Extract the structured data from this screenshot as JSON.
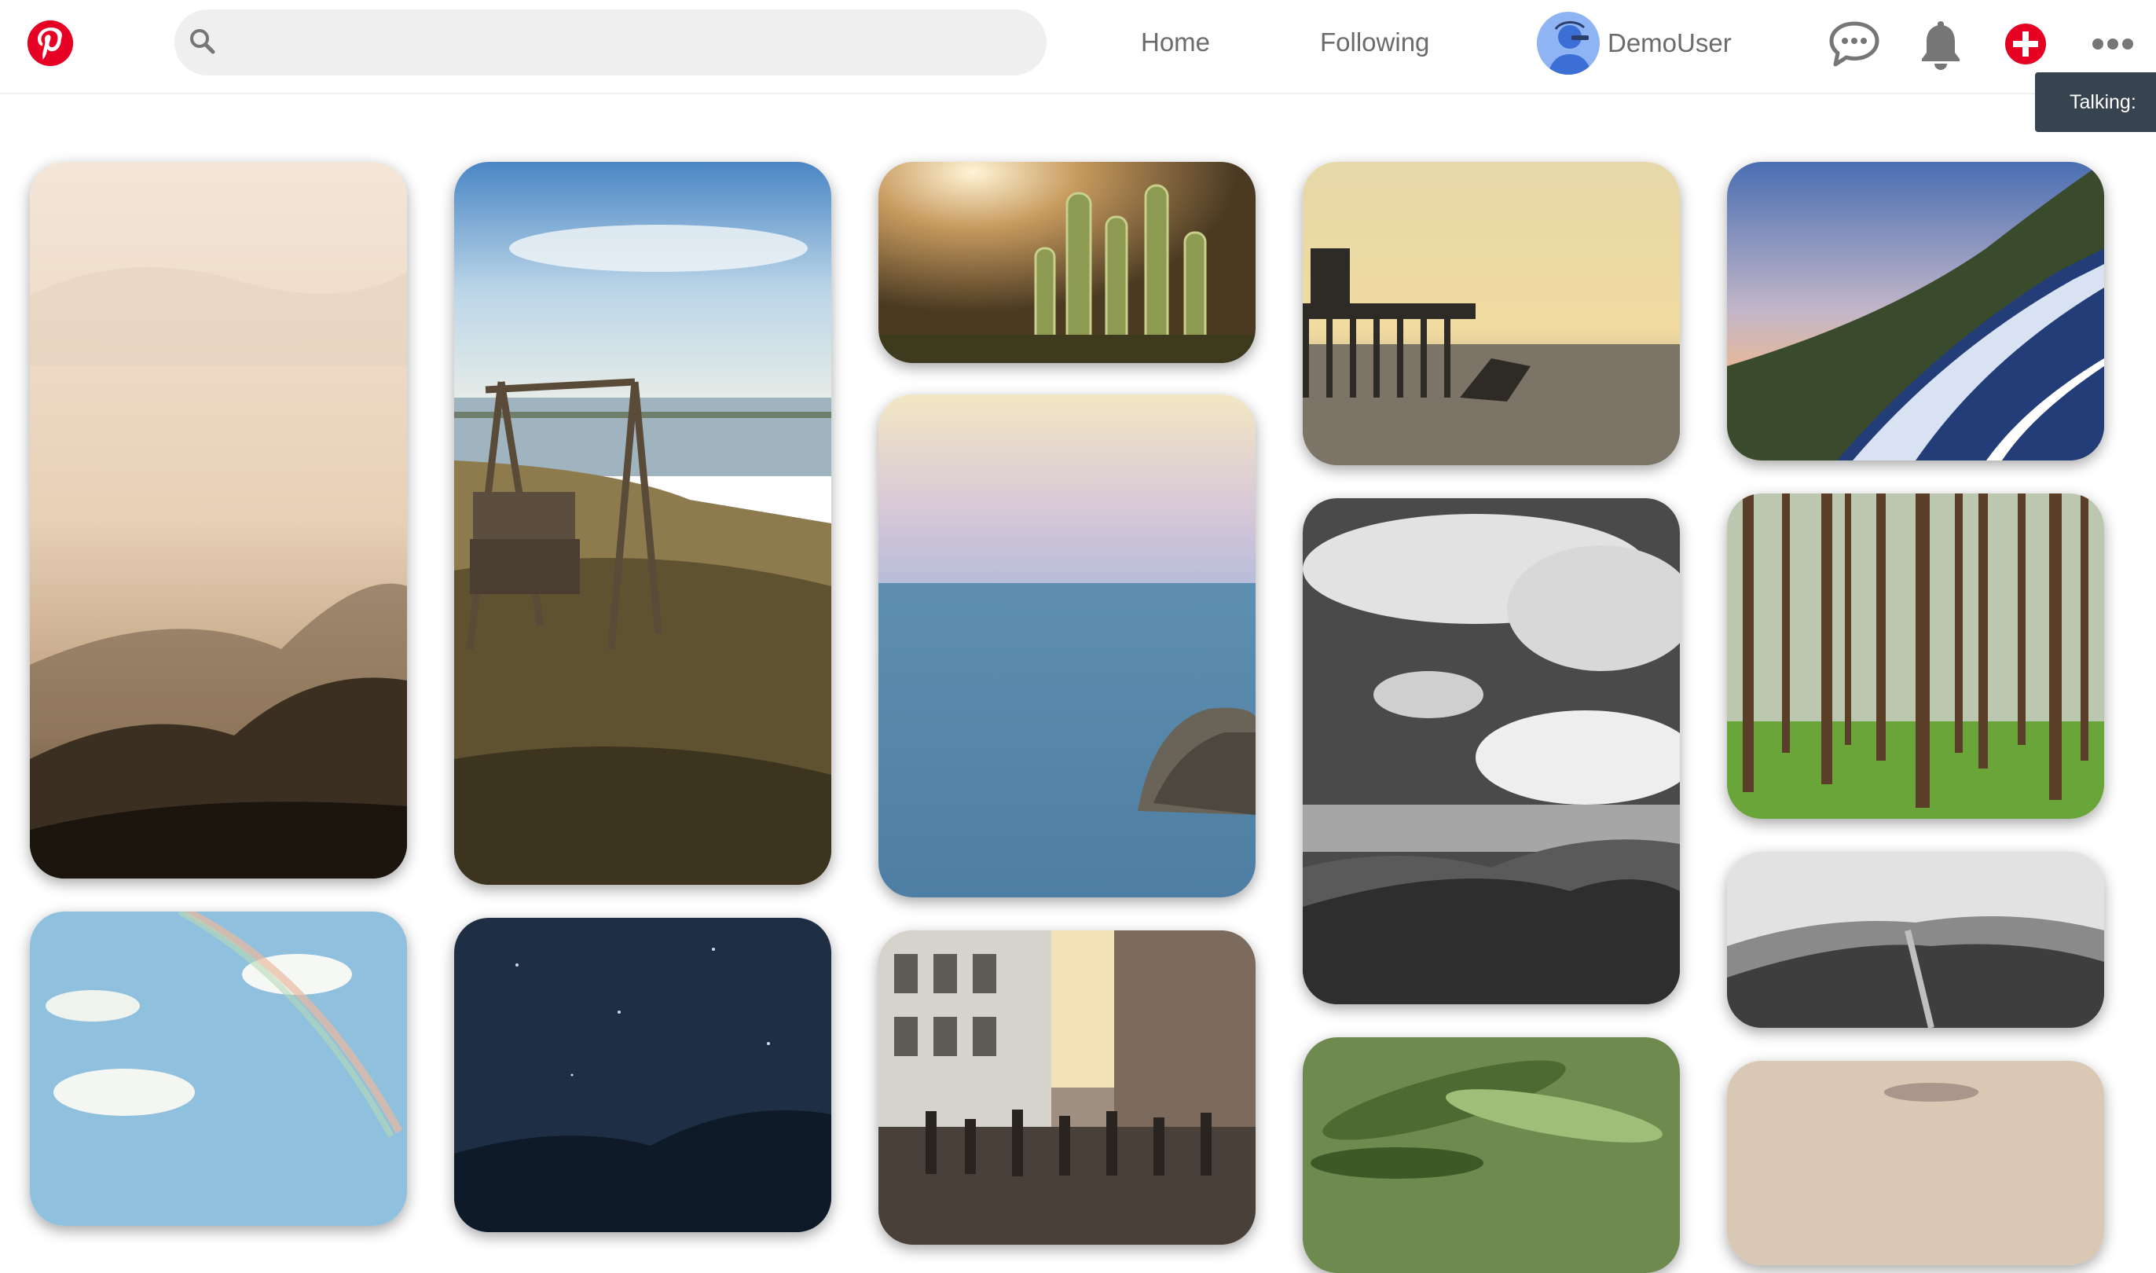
{
  "header": {
    "logo_icon": "pinterest-logo-icon",
    "search": {
      "value": "",
      "placeholder": "",
      "icon": "search-icon"
    },
    "nav": {
      "home": "Home",
      "following": "Following"
    },
    "user": {
      "name": "DemoUser",
      "avatar_icon": "avatar-icon"
    },
    "icons": [
      "chat-bubble-icon",
      "bell-icon",
      "add-plus-icon",
      "more-dots-icon"
    ],
    "brand_color": "#e60023"
  },
  "tooltip": {
    "text": "Talking:"
  },
  "pins": [
    {
      "name": "pin-foggy-mountains",
      "subject": "foggy mountain forest"
    },
    {
      "name": "pin-swing-lake",
      "subject": "wooden swing by lake"
    },
    {
      "name": "pin-cactus",
      "subject": "cactus at sunset"
    },
    {
      "name": "pin-ocean-rock",
      "subject": "ocean with rock"
    },
    {
      "name": "pin-city-street",
      "subject": "busy city street"
    },
    {
      "name": "pin-pier",
      "subject": "old pier at sunset"
    },
    {
      "name": "pin-clouds-bw",
      "subject": "black and white clouds"
    },
    {
      "name": "pin-green-leaves",
      "subject": "green leaves"
    },
    {
      "name": "pin-mountain-road",
      "subject": "mountain road"
    },
    {
      "name": "pin-pine-forest",
      "subject": "pine forest"
    },
    {
      "name": "pin-hill-path-bw",
      "subject": "hill path"
    },
    {
      "name": "pin-sand",
      "subject": "sand"
    },
    {
      "name": "pin-rainbow-sky",
      "subject": "rainbow sky"
    },
    {
      "name": "pin-night-sky",
      "subject": "starry night sky"
    }
  ]
}
